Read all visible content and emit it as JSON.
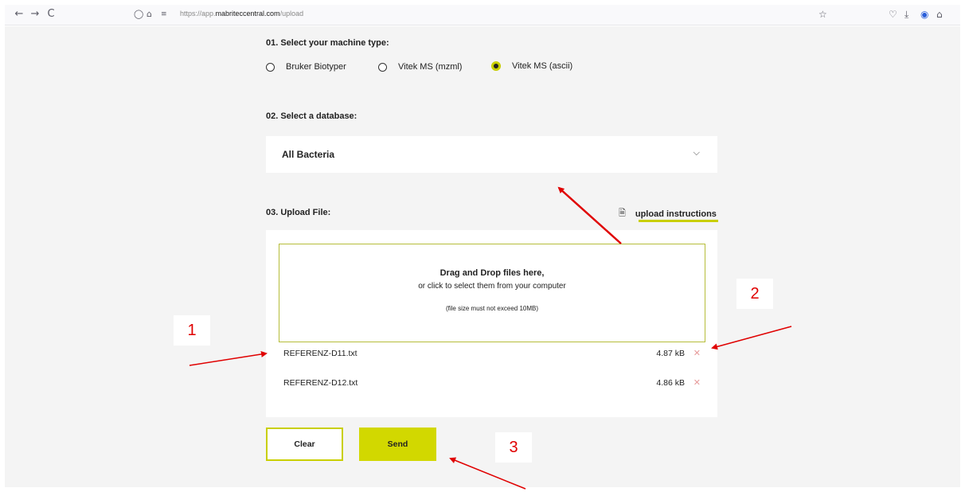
{
  "browser": {
    "back_icon": "←",
    "forward_icon": "→",
    "reload_icon": "C",
    "url_prefix": "https://app.",
    "url_domain": "mabriteccentral.com",
    "url_path": "/upload"
  },
  "machine_type": {
    "heading": "01. Select your machine type:",
    "options": [
      {
        "label": "Bruker Biotyper",
        "selected": false
      },
      {
        "label": "Vitek MS (mzml)",
        "selected": false
      },
      {
        "label": "Vitek MS (ascii)",
        "selected": true
      }
    ]
  },
  "database": {
    "heading": "02. Select a database:",
    "selected": "All Bacteria"
  },
  "upload": {
    "heading": "03. Upload File:",
    "instructions_link": "upload instructions",
    "dropzone_title": "Drag and Drop files here,",
    "dropzone_subtitle": "or click to select them from your computer",
    "dropzone_note": "(file size must not exceed 10MB)",
    "files": [
      {
        "name": "REFERENZ-D11.txt",
        "size": "4.87 kB"
      },
      {
        "name": "REFERENZ-D12.txt",
        "size": "4.86 kB"
      }
    ]
  },
  "actions": {
    "clear_label": "Clear",
    "send_label": "Send"
  },
  "annotations": {
    "callout_1": "1",
    "callout_2": "2",
    "callout_3": "3",
    "arrow_color": "#e00000"
  },
  "colors": {
    "accent": "#d2d800",
    "page_bg": "#f4f4f4",
    "remove_icon": "#e79a9a"
  }
}
